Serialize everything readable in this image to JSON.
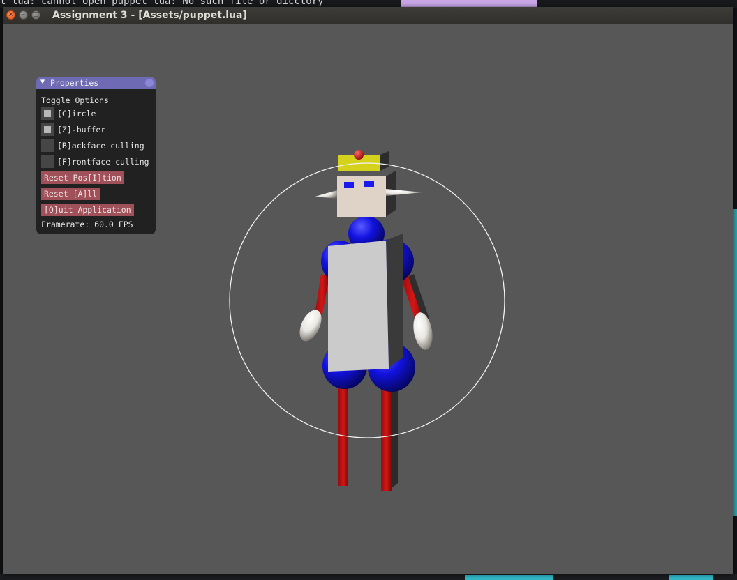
{
  "background": {
    "terminal_text": "t lua: cannot open puppet lua: No such file or dicctory"
  },
  "window": {
    "title": "Assignment 3 - [Assets/puppet.lua]",
    "close_glyph": "×",
    "min_glyph": "–",
    "max_glyph": "□"
  },
  "panel": {
    "title": "Properties",
    "collapse_glyph": "▼",
    "section_label": "Toggle Options",
    "checkboxes": [
      {
        "label": "[C]ircle",
        "checked": true
      },
      {
        "label": "[Z]-buffer",
        "checked": true
      },
      {
        "label": "[B]ackface culling",
        "checked": false
      },
      {
        "label": "[F]rontface culling",
        "checked": false
      }
    ],
    "buttons": {
      "reset_position": "Reset Pos[I]tion",
      "reset_all": "Reset [A]ll",
      "quit": "[Q]uit Application"
    },
    "framerate": "Framerate: 60.0 FPS"
  },
  "colors": {
    "viewport_bg": "#575757",
    "panel_header": "#6e6ab3",
    "button": "#a05058",
    "puppet_red": "#cc1010",
    "puppet_blue": "#1010d8",
    "puppet_skin": "#ded3c6",
    "puppet_crown": "#d4d21a",
    "torso": "#c9c9c9"
  }
}
